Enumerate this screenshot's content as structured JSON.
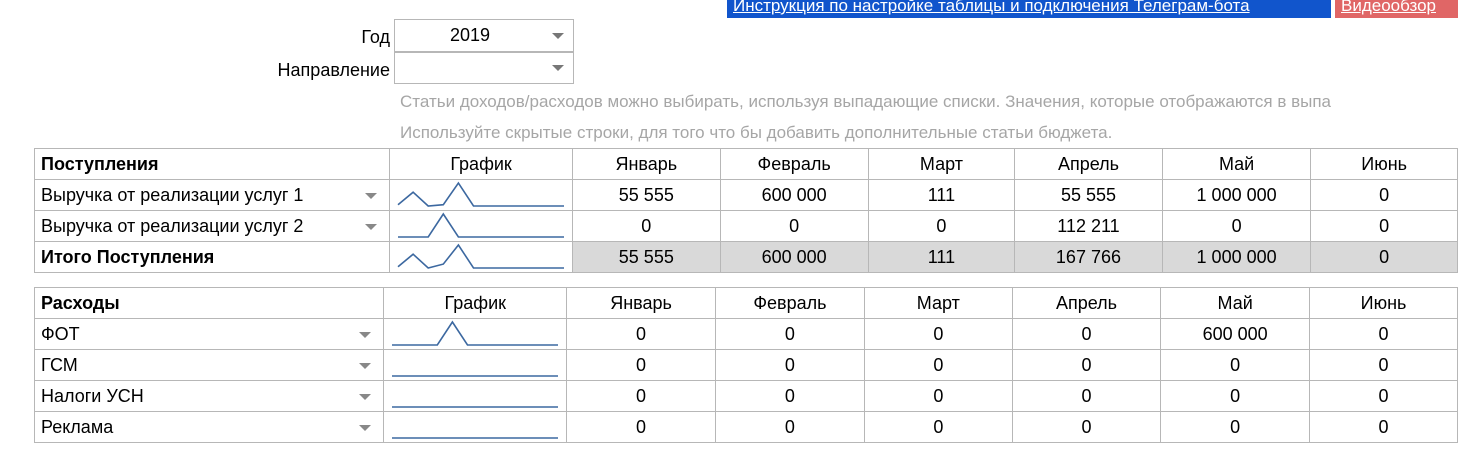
{
  "top_buttons": {
    "guide": "Инструкция по настройке таблицы и подключения Телеграм-бота",
    "video": "Видеообзор"
  },
  "filters": {
    "year_label": "Год",
    "year_value": "2019",
    "direction_label": "Направление",
    "direction_value": ""
  },
  "notes": {
    "line1": "Статьи доходов/расходов можно выбирать, используя выпадающие списки. Значения, которые отображаются в выпа",
    "line2": "Используйте скрытые строки, для того что бы добавить дополнительные статьи бюджета."
  },
  "columns": [
    "График",
    "Январь",
    "Февраль",
    "Март",
    "Апрель",
    "Май",
    "Июнь"
  ],
  "income": {
    "title": "Поступления",
    "rows": [
      {
        "name": "Выручка от реализации услуг 1",
        "values": [
          "55 555",
          "600 000",
          "111",
          "55 555",
          "1 000 000",
          "0"
        ]
      },
      {
        "name": "Выручка от реализации услуг 2",
        "values": [
          "0",
          "0",
          "0",
          "112 211",
          "0",
          "0"
        ]
      }
    ],
    "total": {
      "name": "Итого Поступления",
      "values": [
        "55 555",
        "600 000",
        "111",
        "167 766",
        "1 000 000",
        "0"
      ]
    }
  },
  "expenses": {
    "title": "Расходы",
    "rows": [
      {
        "name": "ФОТ",
        "values": [
          "0",
          "0",
          "0",
          "0",
          "600 000",
          "0"
        ]
      },
      {
        "name": "ГСМ",
        "values": [
          "0",
          "0",
          "0",
          "0",
          "0",
          "0"
        ]
      },
      {
        "name": "Налоги УСН",
        "values": [
          "0",
          "0",
          "0",
          "0",
          "0",
          "0"
        ]
      },
      {
        "name": "Реклама",
        "values": [
          "0",
          "0",
          "0",
          "0",
          "0",
          "0"
        ]
      }
    ]
  },
  "colors": {
    "link_button": "#1155cc",
    "video_button": "#e06666",
    "sparkline": "#3c68a0",
    "total_row": "#d9d9d9"
  }
}
